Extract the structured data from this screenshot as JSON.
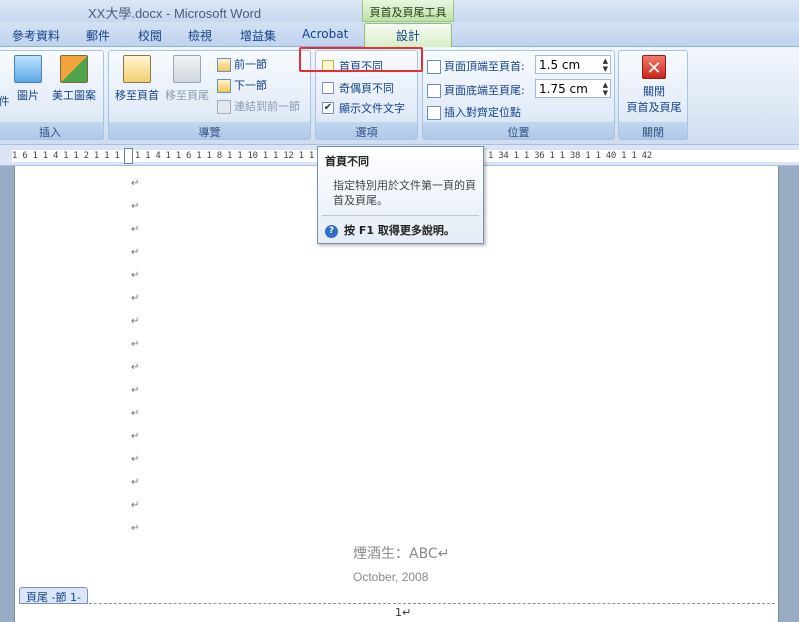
{
  "window": {
    "title": "XX大學.docx - Microsoft Word",
    "context_tab_group": "頁首及頁尾工具"
  },
  "tabs": [
    "參考資料",
    "郵件",
    "校閱",
    "檢視",
    "增益集",
    "Acrobat",
    "設計"
  ],
  "active_tab": "設計",
  "ribbon": {
    "insert_group": {
      "label": "插入",
      "partial_button": "件",
      "picture_button": "圖片",
      "clipart_button": "美工圖案"
    },
    "navigation_group": {
      "label": "導覽",
      "go_to_header": "移至頁首",
      "go_to_footer": "移至頁尾",
      "previous_section": "前一節",
      "next_section": "下一節",
      "link_to_previous": "連結到前一節"
    },
    "options_group": {
      "label": "選項",
      "different_first_page": {
        "label": "首頁不同",
        "checked": false
      },
      "different_odd_even": {
        "label": "奇偶頁不同",
        "checked": false
      },
      "show_document_text": {
        "label": "顯示文件文字",
        "checked": true
      }
    },
    "position_group": {
      "label": "位置",
      "header_from_top_label": "頁面頂端至頁首:",
      "header_from_top_value": "1.5 cm",
      "footer_from_bottom_label": "頁面底端至頁尾:",
      "footer_from_bottom_value": "1.75 cm",
      "insert_alignment_tab": "插入對齊定位點"
    },
    "close_group": {
      "label": "關閉",
      "close_button_line1": "關閉",
      "close_button_line2": "頁首及頁尾"
    }
  },
  "ruler": {
    "text": "1 6 1 1 4 1 1 2 1  1  1 2 1 1 4 1 1 6 1 1 8 1 1 10 1 1 12 1        1 24 1 1 26 1 1 28 1 1 30 1 1 32 1 1 34 1 1 36 1 1 38 1 1 40 1 1 42"
  },
  "tooltip": {
    "title": "首頁不同",
    "description": "指定特別用於文件第一頁的頁首及頁尾。",
    "help": "按 F1 取得更多說明。"
  },
  "document": {
    "paragraph_mark": "↵",
    "empty_paragraph_count": 16,
    "footer_label": "頁尾 -節 1-",
    "footer_line1": "煙酒生：ABC↵",
    "footer_line2": "October, 2008",
    "page_number": "1↵"
  },
  "colors": {
    "ribbon_bg": "#dbe6f4",
    "context_tab": "#bfe0a8",
    "highlight_rect": "#e2312f",
    "doc_background": "#9aabc4"
  }
}
